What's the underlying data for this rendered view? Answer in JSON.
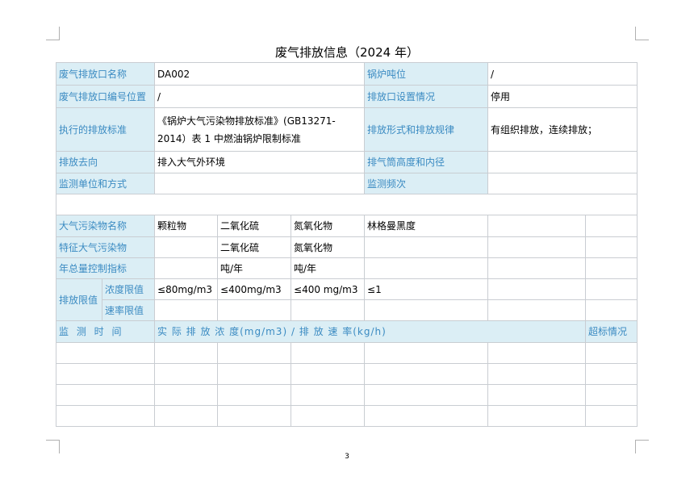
{
  "title": "废气排放信息（2024 年）",
  "page_number": "3",
  "outlet": {
    "name_label": "废气排放口名称",
    "name_value": "DA002",
    "boiler_tonnage_label": "锅炉吨位",
    "boiler_tonnage_value": "/",
    "code_label": "废气排放口编号位置",
    "code_value": "/",
    "setup_label": "排放口设置情况",
    "setup_value": "停用",
    "standard_label": "执行的排放标准",
    "standard_value": "《锅炉大气污染物排放标准》(GB13271-2014）表 1 中燃油锅炉限制标准",
    "form_label": "排放形式和排放规律",
    "form_value": "有组织排放，连续排放；",
    "destination_label": "排放去向",
    "destination_value": "排入大气外环境",
    "stack_label": "排气筒高度和内径",
    "stack_value": "",
    "monitor_unit_label": "监测单位和方式",
    "monitor_unit_value": "",
    "frequency_label": "监测频次",
    "frequency_value": ""
  },
  "pollutants": {
    "name_label": "大气污染物名称",
    "names": [
      "颗粒物",
      "二氧化硫",
      "氮氧化物",
      "林格曼黑度"
    ],
    "characteristic_label": "特征大气污染物",
    "characteristic": [
      "",
      "二氧化硫",
      "氮氧化物",
      ""
    ],
    "annual_label": "年总量控制指标",
    "annual": [
      "",
      "吨/年",
      "吨/年",
      ""
    ],
    "limit_label": "排放限值",
    "concentration_label": "浓度限值",
    "concentration": [
      "≤80mg/m3",
      "≤400mg/m3",
      "≤400 mg/m3",
      "≤1"
    ],
    "rate_label": "速率限值",
    "rate": [
      "",
      "",
      "",
      ""
    ]
  },
  "monitoring": {
    "time_label": "监 测 时 间",
    "concentration_rate_label": "实 际 排 放 浓 度(mg/m3) / 排 放 速 率(kg/h)",
    "exceed_label": "超标情况"
  }
}
